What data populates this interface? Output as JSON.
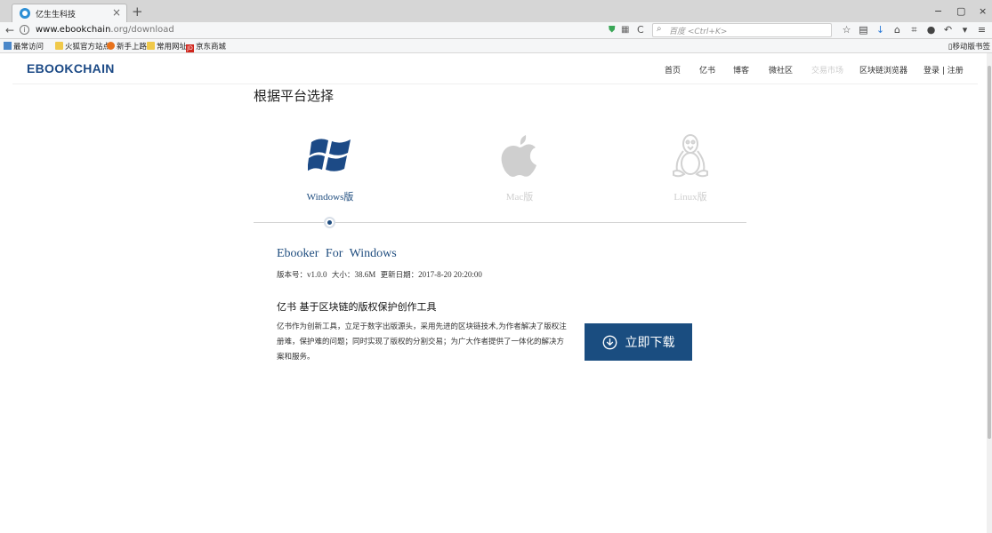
{
  "browser": {
    "tab_title": "亿生生科技",
    "tab_close": "×",
    "new_tab": "+",
    "window_controls": [
      "−",
      "▢",
      "×"
    ],
    "url_host": "www.ebookchain",
    "url_rest": ".org/download",
    "search_placeholder": "百度 <Ctrl+K>",
    "bookmarks": [
      "最常访问",
      "火狐官方站点",
      "新手上路",
      "常用网址",
      "京东商城"
    ],
    "mobile_bookmarks": "移动版书签"
  },
  "site": {
    "logo": "EBOOKCHAIN",
    "nav": [
      "首页",
      "亿书",
      "博客",
      "微社区",
      "交易市场",
      "区块链浏览器",
      "登录 | 注册"
    ]
  },
  "content": {
    "section_title": "根据平台选择",
    "platforms": [
      {
        "label": "Windows版",
        "active": true,
        "icon": "windows-icon"
      },
      {
        "label": "Mac版",
        "active": false,
        "icon": "apple-icon"
      },
      {
        "label": "Linux版",
        "active": false,
        "icon": "linux-icon"
      }
    ],
    "product_title": "Ebooker For Windows",
    "version": {
      "version_label": "版本号：",
      "version_value": "v1.0.0",
      "size_label": "大小：",
      "size_value": "38.6M",
      "date_label": "更新日期：",
      "date_value": "2017-8-20 20:20:00"
    },
    "description_title": "亿书 基于区块链的版权保护创作工具",
    "description": "亿书作为创新工具，立足于数字出版源头，采用先进的区块链技术,为作者解决了版权注册难，保护难的问题；同时实现了版权的分割交易；为广大作者提供了一体化的解决方案和服务。",
    "download_label": "立即下载"
  },
  "colors": {
    "brand": "#1c4a86",
    "button": "#1a4d80",
    "inactive": "#cfcfcf"
  }
}
